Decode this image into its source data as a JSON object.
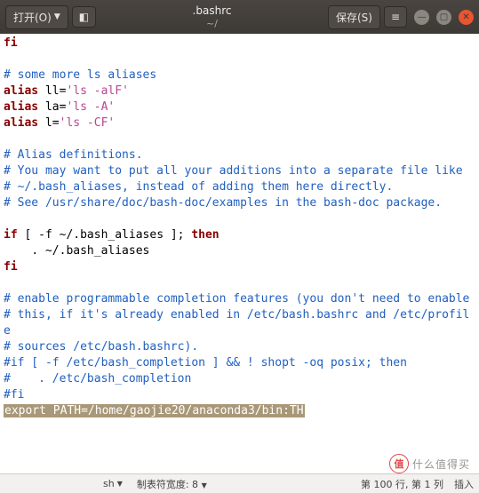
{
  "titlebar": {
    "open_label": "打开(O)",
    "title": ".bashrc",
    "subtitle": "~/",
    "save_label": "保存(S)"
  },
  "code": {
    "l1": "fi",
    "l2": "",
    "l3": "# some more ls aliases",
    "l4k": "alias ",
    "l4a": "ll=",
    "l4s": "'ls -alF'",
    "l5k": "alias ",
    "l5a": "la=",
    "l5s": "'ls -A'",
    "l6k": "alias ",
    "l6a": "l=",
    "l6s": "'ls -CF'",
    "l7": "",
    "l8": "# Alias definitions.",
    "l9": "# You may want to put all your additions into a separate file like",
    "l10": "# ~/.bash_aliases, instead of adding them here directly.",
    "l11": "# See /usr/share/doc/bash-doc/examples in the bash-doc package.",
    "l12": "",
    "l13k": "if ",
    "l13p": "[ -f ~/.bash_aliases ];",
    "l13k2": " then",
    "l14": "    . ~/.bash_aliases",
    "l15": "fi",
    "l16": "",
    "l17": "# enable programmable completion features (you don't need to enable",
    "l18": "# this, if it's already enabled in /etc/bash.bashrc and /etc/profile",
    "l19": "# sources /etc/bash.bashrc).",
    "l20": "#if [ -f /etc/bash_completion ] && ! shopt -oq posix; then",
    "l21": "#    . /etc/bash_completion",
    "l22": "#fi",
    "l23k": "export",
    "l23s": " PATH=/home/gaojie20/anaconda3/bin:",
    "l23e": "TH"
  },
  "statusbar": {
    "lang": "sh",
    "tabwidth": "制表符宽度: 8",
    "position": "第 100 行, 第 1 列",
    "mode": "插入"
  },
  "watermark": {
    "badge": "值",
    "text": "什么值得买"
  }
}
